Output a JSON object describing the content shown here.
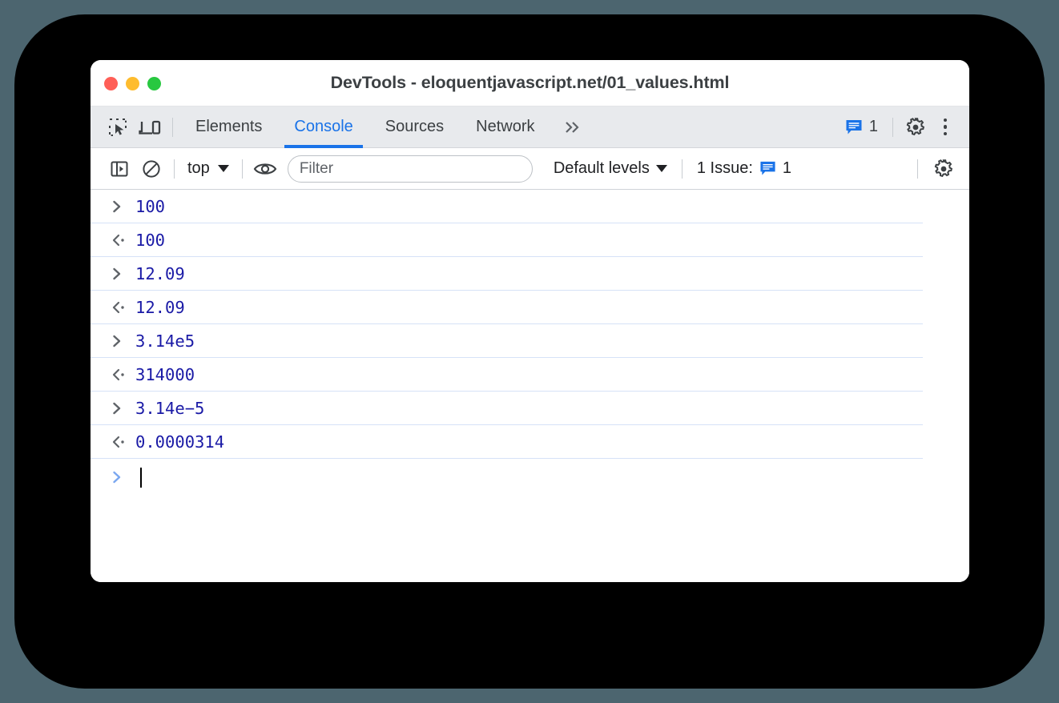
{
  "window": {
    "title": "DevTools - eloquentjavascript.net/01_values.html",
    "traffic_lights": [
      {
        "name": "close",
        "color": "#ff5f57"
      },
      {
        "name": "minimize",
        "color": "#febc2e"
      },
      {
        "name": "zoom",
        "color": "#28c840"
      }
    ]
  },
  "tabbar": {
    "inspect_icon": "inspect-element-icon",
    "device_icon": "device-toolbar-icon",
    "tabs": [
      {
        "label": "Elements",
        "active": false
      },
      {
        "label": "Console",
        "active": true
      },
      {
        "label": "Sources",
        "active": false
      },
      {
        "label": "Network",
        "active": false
      }
    ],
    "overflow_label": "»",
    "issue_count": "1",
    "settings_icon": "gear-icon",
    "more_icon": "kebab-menu-icon",
    "accent_color": "#1a73e8"
  },
  "console_toolbar": {
    "sidebar_icon": "console-sidebar-icon",
    "clear_icon": "clear-console-icon",
    "context": "top",
    "eye_icon": "live-expression-eye-icon",
    "filter_placeholder": "Filter",
    "filter_value": "",
    "levels": "Default levels",
    "issues_label": "1 Issue:",
    "issues_count": "1",
    "settings_icon": "console-settings-gear-icon"
  },
  "console": {
    "rows": [
      {
        "marker": "input",
        "text": "100"
      },
      {
        "marker": "output",
        "text": "100"
      },
      {
        "marker": "input",
        "text": "12.09"
      },
      {
        "marker": "output",
        "text": "12.09"
      },
      {
        "marker": "input",
        "text": "3.14e5"
      },
      {
        "marker": "output",
        "text": "314000"
      },
      {
        "marker": "input",
        "text": "3.14e−5"
      },
      {
        "marker": "output",
        "text": "0.0000314"
      }
    ],
    "prompt_value": "",
    "value_color": "#1a1aa6",
    "separator_color": "#d6e2f7"
  }
}
